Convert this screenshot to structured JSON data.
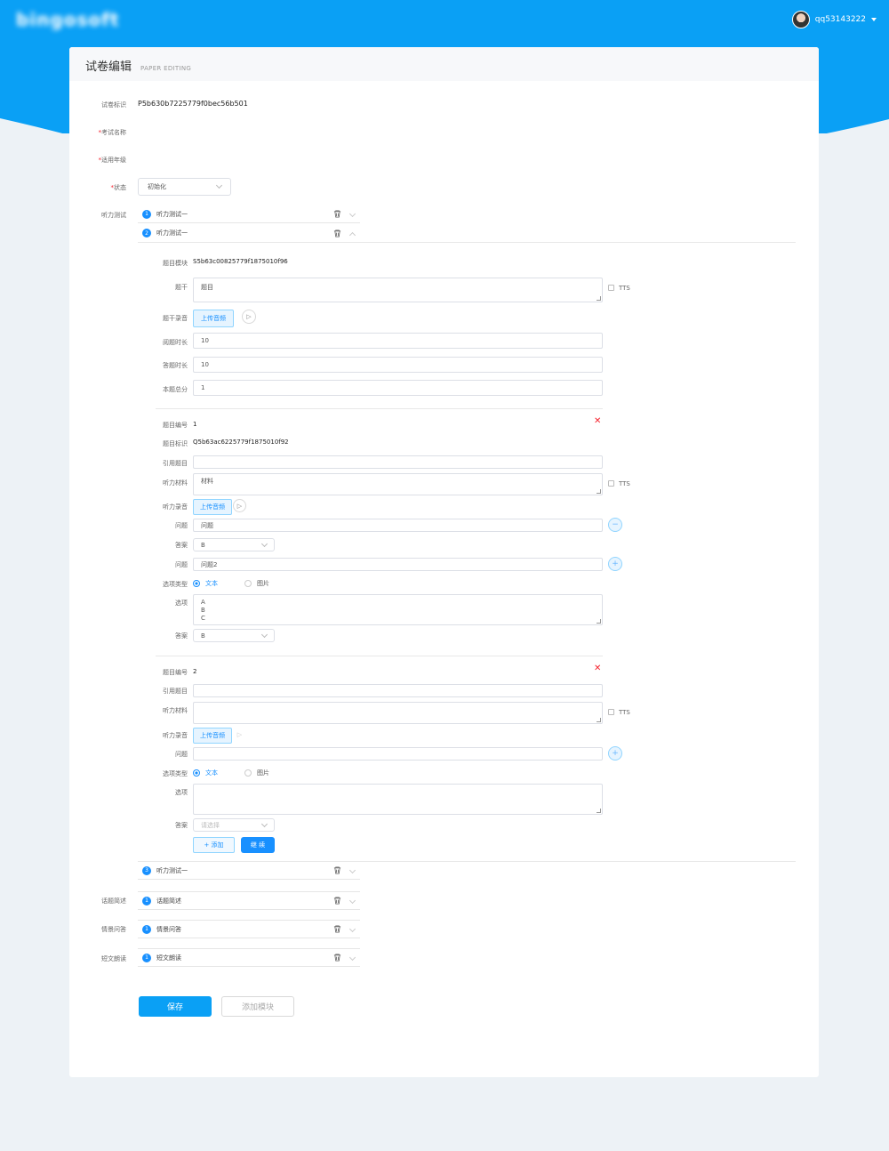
{
  "header": {
    "logo_text": "bingosoft",
    "username": "qq53143222"
  },
  "card": {
    "title": "试卷编辑",
    "subtitle": "PAPER EDITING"
  },
  "form": {
    "paper_id_label": "试卷标识",
    "paper_id": "P5b630b7225779f0bec56b501",
    "exam_name_label": "考试名称",
    "grade_label": "适用年级",
    "status_label": "状态",
    "status_value": "初始化",
    "listening_label": "听力测试",
    "topic_label": "话题简述",
    "scene_label": "情景问答",
    "reading_label": "短文朗读"
  },
  "listening_items": [
    {
      "num": "1",
      "title": "听力测试一"
    },
    {
      "num": "2",
      "title": "听力测试一"
    },
    {
      "num": "3",
      "title": "听力测试一"
    }
  ],
  "other_sections": {
    "topic": {
      "num": "1",
      "title": "话题简述"
    },
    "scene": {
      "num": "1",
      "title": "情景问答"
    },
    "reading": {
      "num": "1",
      "title": "短文朗读"
    }
  },
  "module": {
    "module_id_label": "题目模块",
    "module_id": "S5b63c00825779f1875010f96",
    "stem_label": "题干",
    "stem_value": "题目",
    "tts_label": "TTS",
    "stem_audio_label": "题干录音",
    "upload_label": "上传音频",
    "read_time_label": "阅题时长",
    "read_time": "10",
    "answer_time_label": "答题时长",
    "answer_time": "10",
    "score_label": "本题总分",
    "score": "1"
  },
  "q1": {
    "no_label": "题目编号",
    "no": "1",
    "id_label": "题目标识",
    "id": "Q5b63ac6225779f1875010f92",
    "ref_label": "引用题目",
    "material_label": "听力材料",
    "material": "材料",
    "audio_label": "听力录音",
    "question_label": "问题",
    "question1": "问题",
    "answer_label": "答案",
    "answer1": "B",
    "question2": "问题2",
    "option_type_label": "选项类型",
    "type_text": "文本",
    "type_image": "图片",
    "options_label": "选项",
    "opt_a": "A",
    "opt_b": "B",
    "opt_c": "C",
    "answer2": "B"
  },
  "q2": {
    "no_label": "题目编号",
    "no": "2",
    "ref_label": "引用题目",
    "material_label": "听力材料",
    "audio_label": "听力录音",
    "question_label": "问题",
    "option_type_label": "选项类型",
    "type_text": "文本",
    "type_image": "图片",
    "options_label": "选项",
    "answer_label": "答案",
    "answer_placeholder": "请选择",
    "add_label": "+ 添加",
    "continue_label": "继 续"
  },
  "actions": {
    "save": "保存",
    "add_module": "添加模块"
  },
  "colors": {
    "brand": "#0aa0f5",
    "accent": "#1890ff",
    "danger": "#f5222d"
  }
}
